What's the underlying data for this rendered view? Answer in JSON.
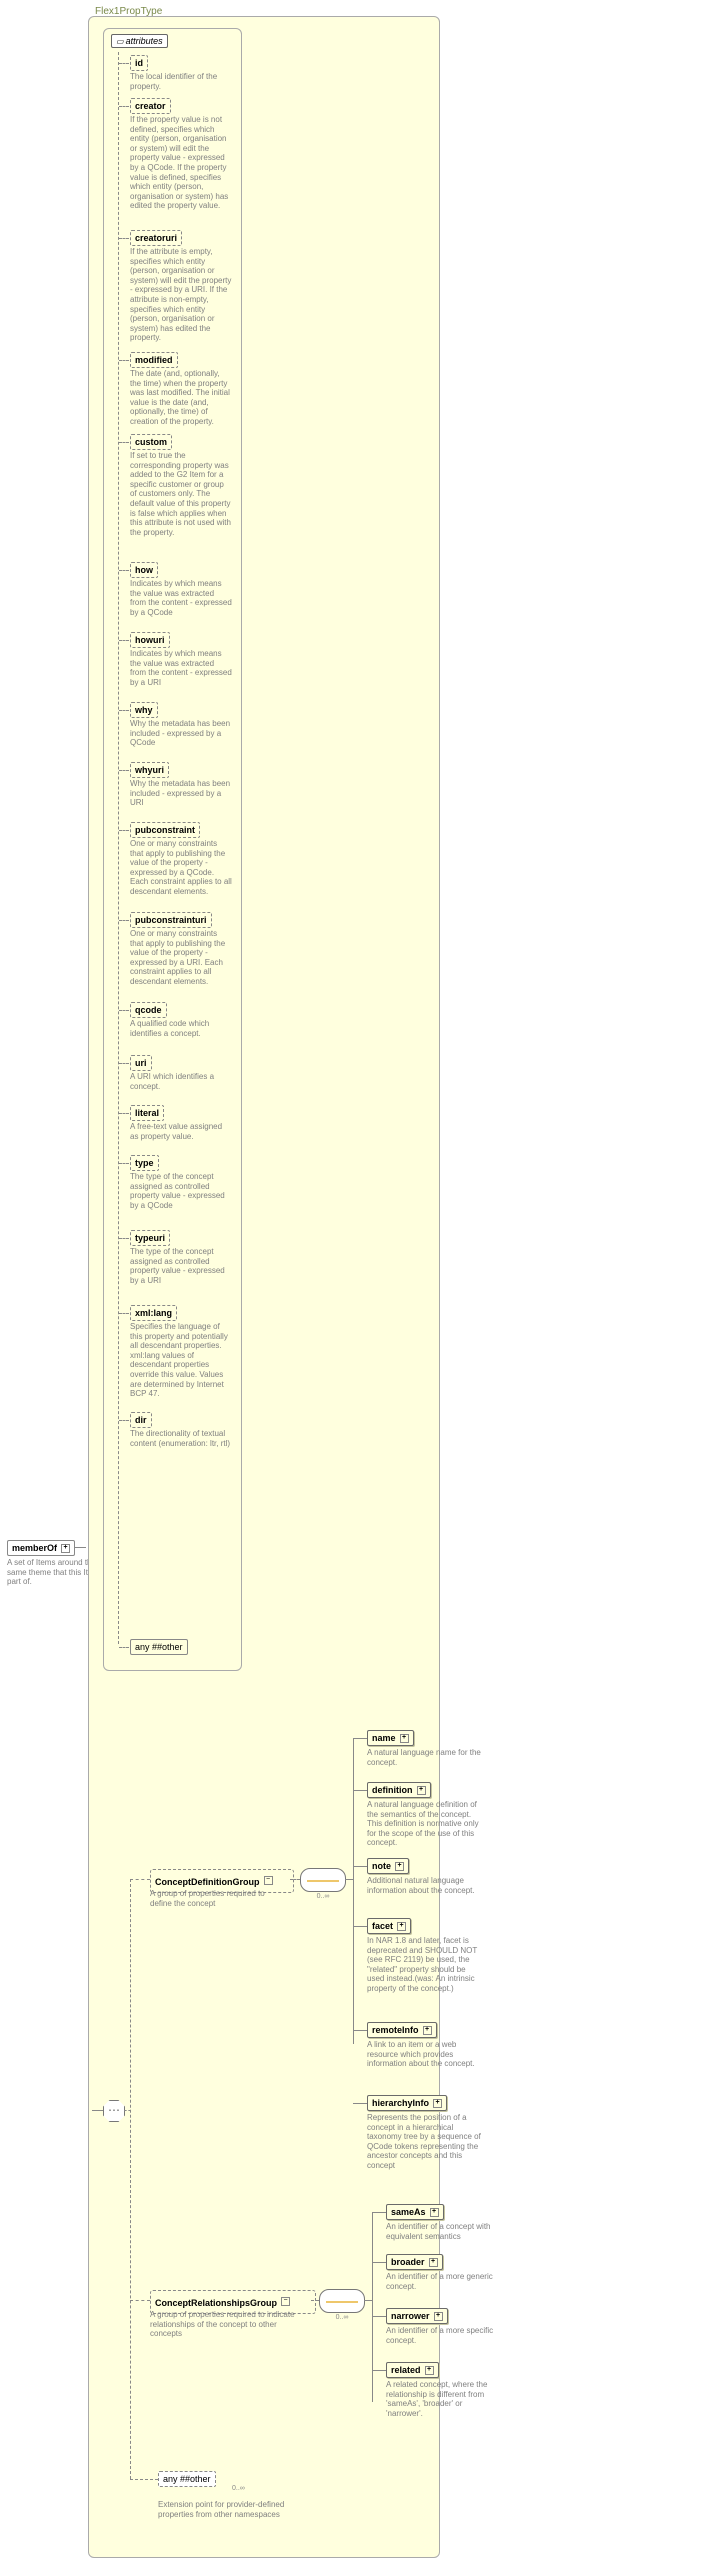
{
  "type_name": "Flex1PropType",
  "memberOf": {
    "label": "memberOf",
    "desc": "A set of Items around the same theme that this Item is part of."
  },
  "attributes_label": "attributes",
  "attributes": [
    {
      "name": "id",
      "desc": "The local identifier of the property."
    },
    {
      "name": "creator",
      "desc": "If the property value is not defined, specifies which entity (person, organisation or system) will edit the property value - expressed by a QCode. If the property value is defined, specifies which entity (person, organisation or system) has edited the property value."
    },
    {
      "name": "creatoruri",
      "desc": "If the attribute is empty, specifies which entity (person, organisation or system) will edit the property - expressed by a URI. If the attribute is non-empty, specifies which entity (person, organisation or system) has edited the property."
    },
    {
      "name": "modified",
      "desc": "The date (and, optionally, the time) when the property was last modified. The initial value is the date (and, optionally, the time) of creation of the property."
    },
    {
      "name": "custom",
      "desc": "If set to true the corresponding property was added to the G2 Item for a specific customer or group of customers only. The default value of this property is false which applies when this attribute is not used with the property."
    },
    {
      "name": "how",
      "desc": "Indicates by which means the value was extracted from the content - expressed by a QCode"
    },
    {
      "name": "howuri",
      "desc": "Indicates by which means the value was extracted from the content - expressed by a URI"
    },
    {
      "name": "why",
      "desc": "Why the metadata has been included - expressed by a QCode"
    },
    {
      "name": "whyuri",
      "desc": "Why the metadata has been included - expressed by a URI"
    },
    {
      "name": "pubconstraint",
      "desc": "One or many constraints that apply to publishing the value of the property - expressed by a QCode. Each constraint applies to all descendant elements."
    },
    {
      "name": "pubconstrainturi",
      "desc": "One or many constraints that apply to publishing the value of the property - expressed by a URI. Each constraint applies to all descendant elements."
    },
    {
      "name": "qcode",
      "desc": "A qualified code which identifies a concept."
    },
    {
      "name": "uri",
      "desc": "A URI which identifies a concept."
    },
    {
      "name": "literal",
      "desc": "A free-text value assigned as property value."
    },
    {
      "name": "type",
      "desc": "The type of the concept assigned as controlled property value - expressed by a QCode"
    },
    {
      "name": "typeuri",
      "desc": "The type of the concept assigned as controlled property value - expressed by a URI"
    },
    {
      "name": "xml:lang",
      "desc": "Specifies the language of this property and potentially all descendant properties. xml:lang values of descendant properties override this value. Values are determined by Internet BCP 47."
    },
    {
      "name": "dir",
      "desc": "The directionality of textual content (enumeration: ltr, rtl)"
    }
  ],
  "any_other": "any ##other",
  "groups": {
    "def": {
      "label": "ConceptDefinitionGroup",
      "desc": "A group of properties required to define the concept"
    },
    "rel": {
      "label": "ConceptRelationshipsGroup",
      "desc": "A group of properties required to indicate relationships of the concept to other concepts"
    }
  },
  "def_children": [
    {
      "name": "name",
      "desc": "A natural language name for the concept."
    },
    {
      "name": "definition",
      "desc": "A natural language definition of the semantics of the concept. This definition is normative only for the scope of the use of this concept."
    },
    {
      "name": "note",
      "desc": "Additional natural language information about the concept."
    },
    {
      "name": "facet",
      "desc": "In NAR 1.8 and later, facet is deprecated and SHOULD NOT (see RFC 2119) be used, the \"related\" property should be used instead.(was: An intrinsic property of the concept.)"
    },
    {
      "name": "remoteInfo",
      "desc": "A link to an item or a web resource which provides information about the concept."
    },
    {
      "name": "hierarchyInfo",
      "desc": "Represents the position of a concept in a hierarchical taxonomy tree by a sequence of QCode tokens representing the ancestor concepts and this concept"
    }
  ],
  "rel_children": [
    {
      "name": "sameAs",
      "desc": "An identifier of a concept with equivalent semantics"
    },
    {
      "name": "broader",
      "desc": "An identifier of a more generic concept."
    },
    {
      "name": "narrower",
      "desc": "An identifier of a more specific concept."
    },
    {
      "name": "related",
      "desc": "A related concept, where the relationship is different from 'sameAs', 'broader' or 'narrower'."
    }
  ],
  "ext_any": {
    "label": "any ##other",
    "desc": "Extension point for provider-defined properties from other namespaces"
  },
  "occurs": "0..∞"
}
